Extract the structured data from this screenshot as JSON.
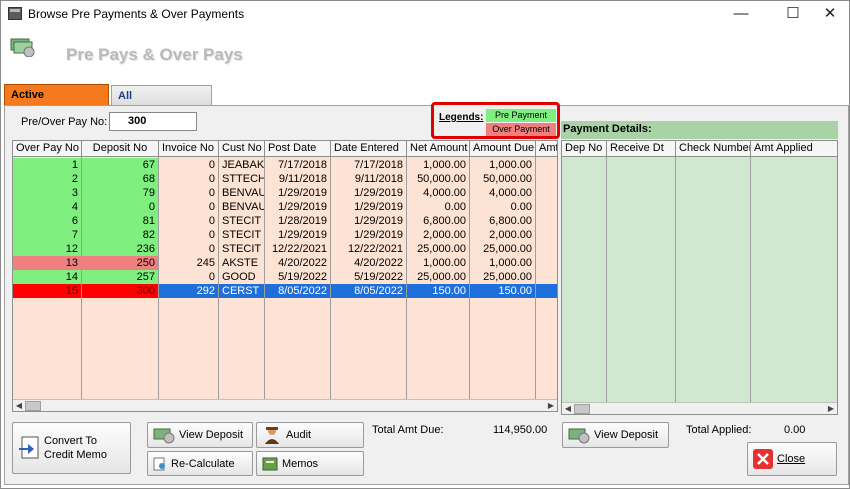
{
  "window": {
    "title": "Browse Pre Payments & Over Payments",
    "minimize": "—",
    "maximize": "☐",
    "close": "✕"
  },
  "header": {
    "title": "Pre Pays & Over Pays"
  },
  "tabs": [
    {
      "label": "Active"
    },
    {
      "label": "All"
    }
  ],
  "payno": {
    "label": "Pre/Over Pay No:",
    "value": "300"
  },
  "legend": {
    "label": "Legends:",
    "pre": "Pre Payment",
    "over": "Over Payment",
    "pre_color": "#7fef7f",
    "over_color": "#f08080"
  },
  "left_grid": {
    "columns": [
      "Over Pay No",
      "Deposit No",
      "Invoice No",
      "Cust No",
      "Post Date",
      "Date Entered",
      "Net Amount",
      "Amount Due",
      "Amt"
    ],
    "rows": [
      {
        "type": "pre",
        "c": [
          "1",
          "67",
          "0",
          "JEABAK",
          "7/17/2018",
          "7/17/2018",
          "1,000.00",
          "1,000.00"
        ]
      },
      {
        "type": "pre",
        "c": [
          "2",
          "68",
          "0",
          "STTECH",
          "9/11/2018",
          "9/11/2018",
          "50,000.00",
          "50,000.00"
        ]
      },
      {
        "type": "pre",
        "c": [
          "3",
          "79",
          "0",
          "BENVAU",
          "1/29/2019",
          "1/29/2019",
          "4,000.00",
          "4,000.00"
        ]
      },
      {
        "type": "pre",
        "c": [
          "4",
          "0",
          "0",
          "BENVAU",
          "1/29/2019",
          "1/29/2019",
          "0.00",
          "0.00"
        ]
      },
      {
        "type": "pre",
        "c": [
          "6",
          "81",
          "0",
          "STECIT",
          "1/28/2019",
          "1/29/2019",
          "6,800.00",
          "6,800.00"
        ]
      },
      {
        "type": "pre",
        "c": [
          "7",
          "82",
          "0",
          "STECIT",
          "1/29/2019",
          "1/29/2019",
          "2,000.00",
          "2,000.00"
        ]
      },
      {
        "type": "pre",
        "c": [
          "12",
          "236",
          "0",
          "STECIT",
          "12/22/2021",
          "12/22/2021",
          "25,000.00",
          "25,000.00"
        ]
      },
      {
        "type": "over",
        "c": [
          "13",
          "250",
          "245",
          "AKSTE",
          "4/20/2022",
          "4/20/2022",
          "1,000.00",
          "1,000.00"
        ]
      },
      {
        "type": "pre",
        "c": [
          "14",
          "257",
          "0",
          "GOOD",
          "5/19/2022",
          "5/19/2022",
          "25,000.00",
          "25,000.00"
        ]
      },
      {
        "type": "selected",
        "c": [
          "15",
          "300",
          "292",
          "CERST",
          "8/05/2022",
          "8/05/2022",
          "150.00",
          "150.00"
        ]
      }
    ]
  },
  "right_grid": {
    "title": "Payment Details:",
    "columns": [
      "Dep No",
      "Receive Dt",
      "Check Number",
      "Amt Applied"
    ]
  },
  "buttons": {
    "convert": "Convert To Credit Memo",
    "view_deposit": "View Deposit",
    "audit": "Audit",
    "recalculate": "Re-Calculate",
    "memos": "Memos",
    "view_deposit2": "View Deposit",
    "close": "Close"
  },
  "summary": {
    "total_due_label": "Total Amt Due:",
    "total_due_value": "114,950.00",
    "total_applied_label": "Total Applied:",
    "total_applied_value": "0.00"
  }
}
